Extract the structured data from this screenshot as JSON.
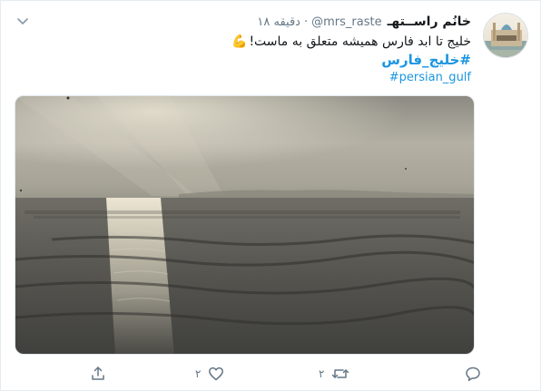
{
  "tweet": {
    "author_name": "خانُم راســتهـ",
    "handle": "@mrs_raste",
    "separator": "·",
    "time": "۱۸ دقیقه",
    "text": "خلیج تا ابد فارس همیشه متعلق به ماست!",
    "emoji": "💪",
    "hashtags": [
      "#خلیج_فارس",
      "#persian_gulf"
    ]
  },
  "actions": {
    "reply_count": "",
    "retweet_count": "۲",
    "like_count": "۲",
    "share_count": ""
  },
  "icons": {
    "caret": "chevron-down-icon",
    "reply": "comment-icon",
    "retweet": "retweet-icon",
    "like": "heart-icon",
    "share": "share-icon"
  },
  "colors": {
    "link": "#1b95e0",
    "muted": "#657786",
    "text": "#14171a"
  }
}
